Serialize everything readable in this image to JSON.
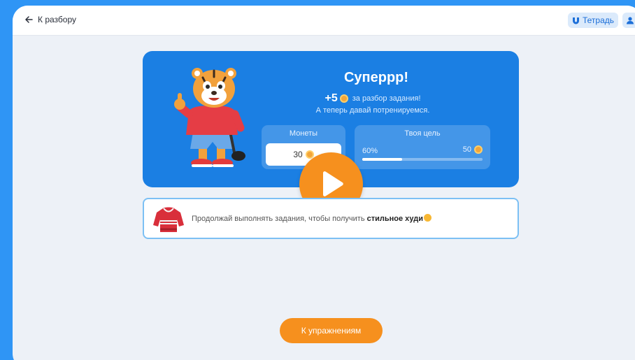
{
  "header": {
    "back_label": "К разбору",
    "notebook_label": "Тетрадь"
  },
  "card": {
    "title": "Суперрр!",
    "reward_amount": "+5",
    "reward_text": "за разбор задания!",
    "subtitle": "А теперь давай потренируемся.",
    "coins": {
      "label": "Монеты",
      "value": "30"
    },
    "goal": {
      "label": "Твоя цель",
      "percent_label": "60%",
      "progress": 0.33,
      "target": "50"
    }
  },
  "banner": {
    "text_prefix": "Продолжай выполнять задания, чтобы получить",
    "text_bold": "стильное худи"
  },
  "footer": {
    "exercises_label": "К упражнениям"
  },
  "colors": {
    "page_bg": "#2f95f5",
    "card_bg": "#1b7fe3",
    "accent_orange": "#f6901e",
    "coin": "#f3a63a"
  }
}
